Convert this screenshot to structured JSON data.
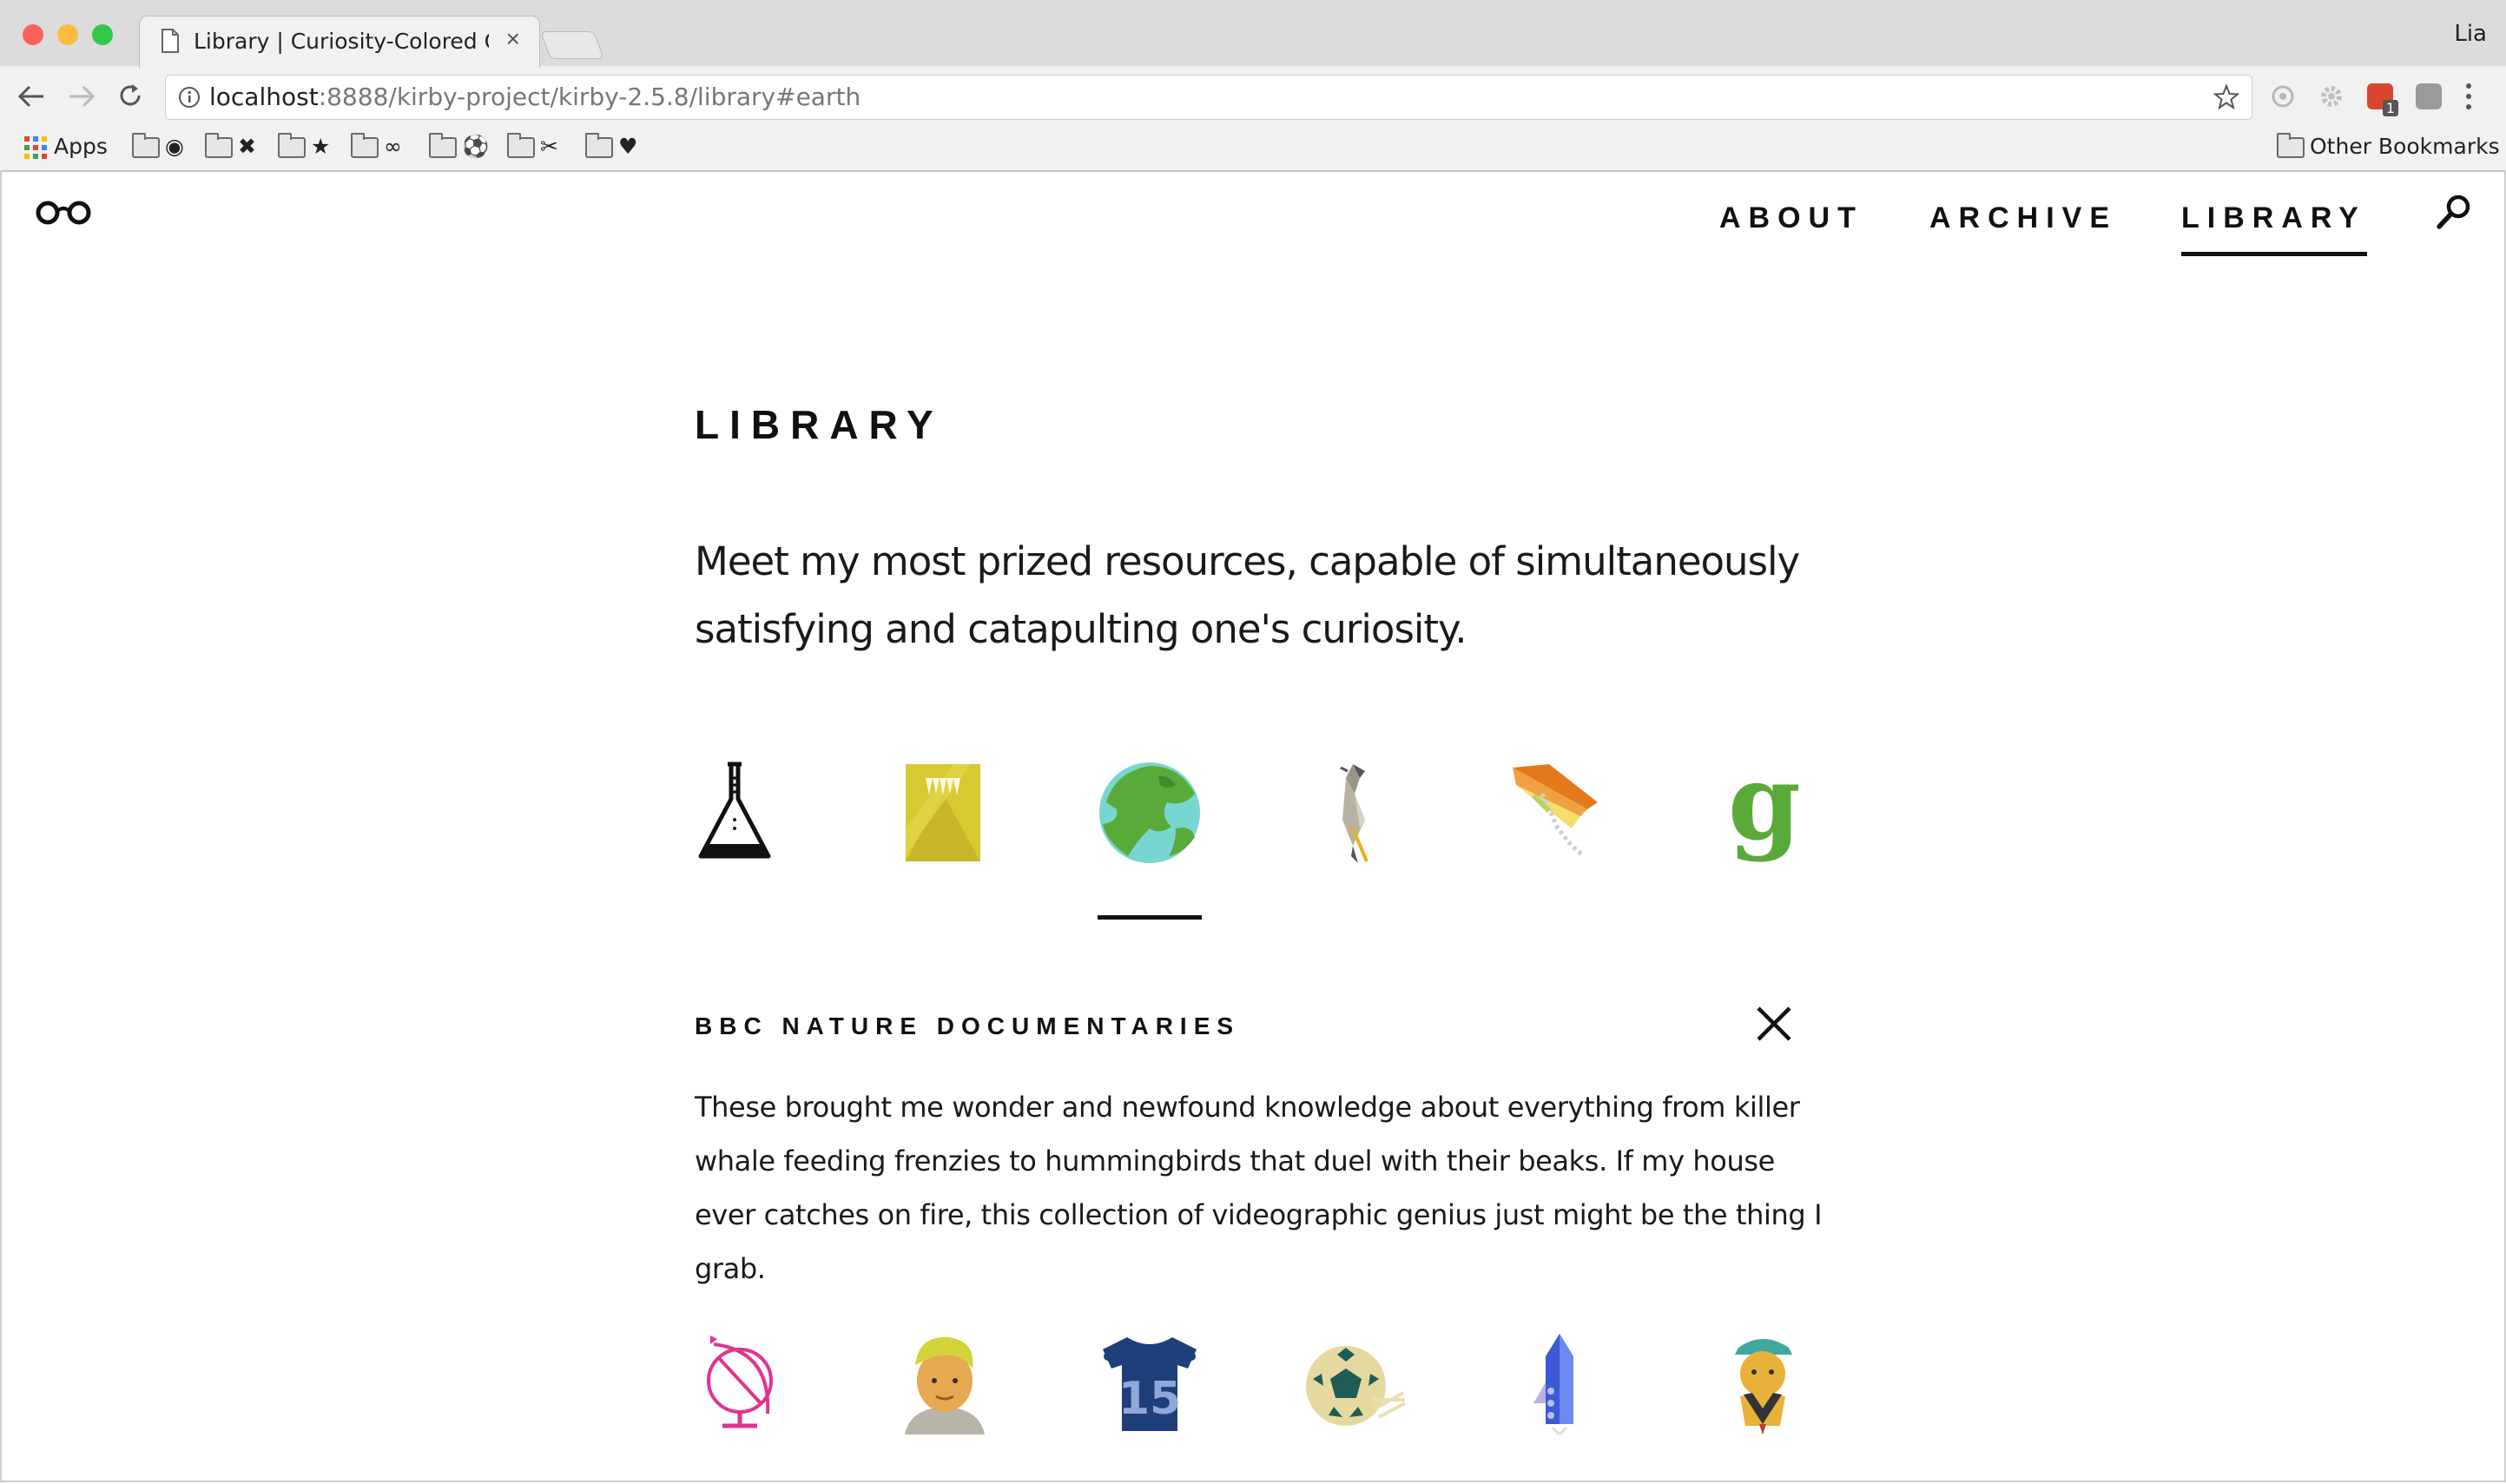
{
  "browser": {
    "tab_title": "Library | Curiosity-Colored Gla",
    "tab_close": "×",
    "profile_name": "Lia",
    "url_host": "localhost",
    "url_rest": ":8888/kirby-project/kirby-2.5.8/library#earth",
    "nav_icons": {
      "back": "back-arrow-icon",
      "forward": "forward-arrow-icon",
      "reload": "reload-icon"
    },
    "bookmarks": [
      {
        "label": "Apps",
        "icon": "apps-grid-icon"
      },
      {
        "label": "◉",
        "icon": "folder-icon"
      },
      {
        "label": "✖",
        "icon": "folder-icon"
      },
      {
        "label": "★",
        "icon": "folder-icon"
      },
      {
        "label": "∞",
        "icon": "folder-icon"
      },
      {
        "label": "⚽",
        "icon": "folder-icon"
      },
      {
        "label": "✂",
        "icon": "folder-icon"
      },
      {
        "label": "♥",
        "icon": "folder-icon"
      }
    ],
    "other_bookmarks": "Other Bookmarks",
    "extension_badge": "1"
  },
  "site": {
    "nav": {
      "about": "ABOUT",
      "archive": "ARCHIVE",
      "library": "LIBRARY",
      "active": "library"
    },
    "page_title": "LIBRARY",
    "intro": "Meet my most prized resources, capable of simultaneously satisfying and catapulting one's curiosity.",
    "resource_icons_row1": [
      "flask-icon",
      "yellow-book-icon",
      "earth-globe-icon",
      "bird-icon",
      "kite-icon",
      "google-g-icon"
    ],
    "active_resource": "earth-globe-icon",
    "detail": {
      "title": "BBC NATURE DOCUMENTARIES",
      "body": "These brought me wonder and newfound knowledge about everything from killer whale feeding frenzies to hummingbirds that duel with their beaks. If my house ever catches on fire, this collection of videographic genius just might be the thing I grab."
    },
    "resource_icons_row2": [
      "globe-stand-icon",
      "boy-portrait-icon",
      "jersey-15-icon",
      "soccer-ball-icon",
      "rocket-icon",
      "scout-figure-icon"
    ],
    "jersey_number": "15",
    "colors": {
      "text": "#111111",
      "green": "#5aaa3a",
      "yellow": "#d8c832",
      "navy": "#1f3f7a",
      "magenta": "#e0338f"
    }
  }
}
